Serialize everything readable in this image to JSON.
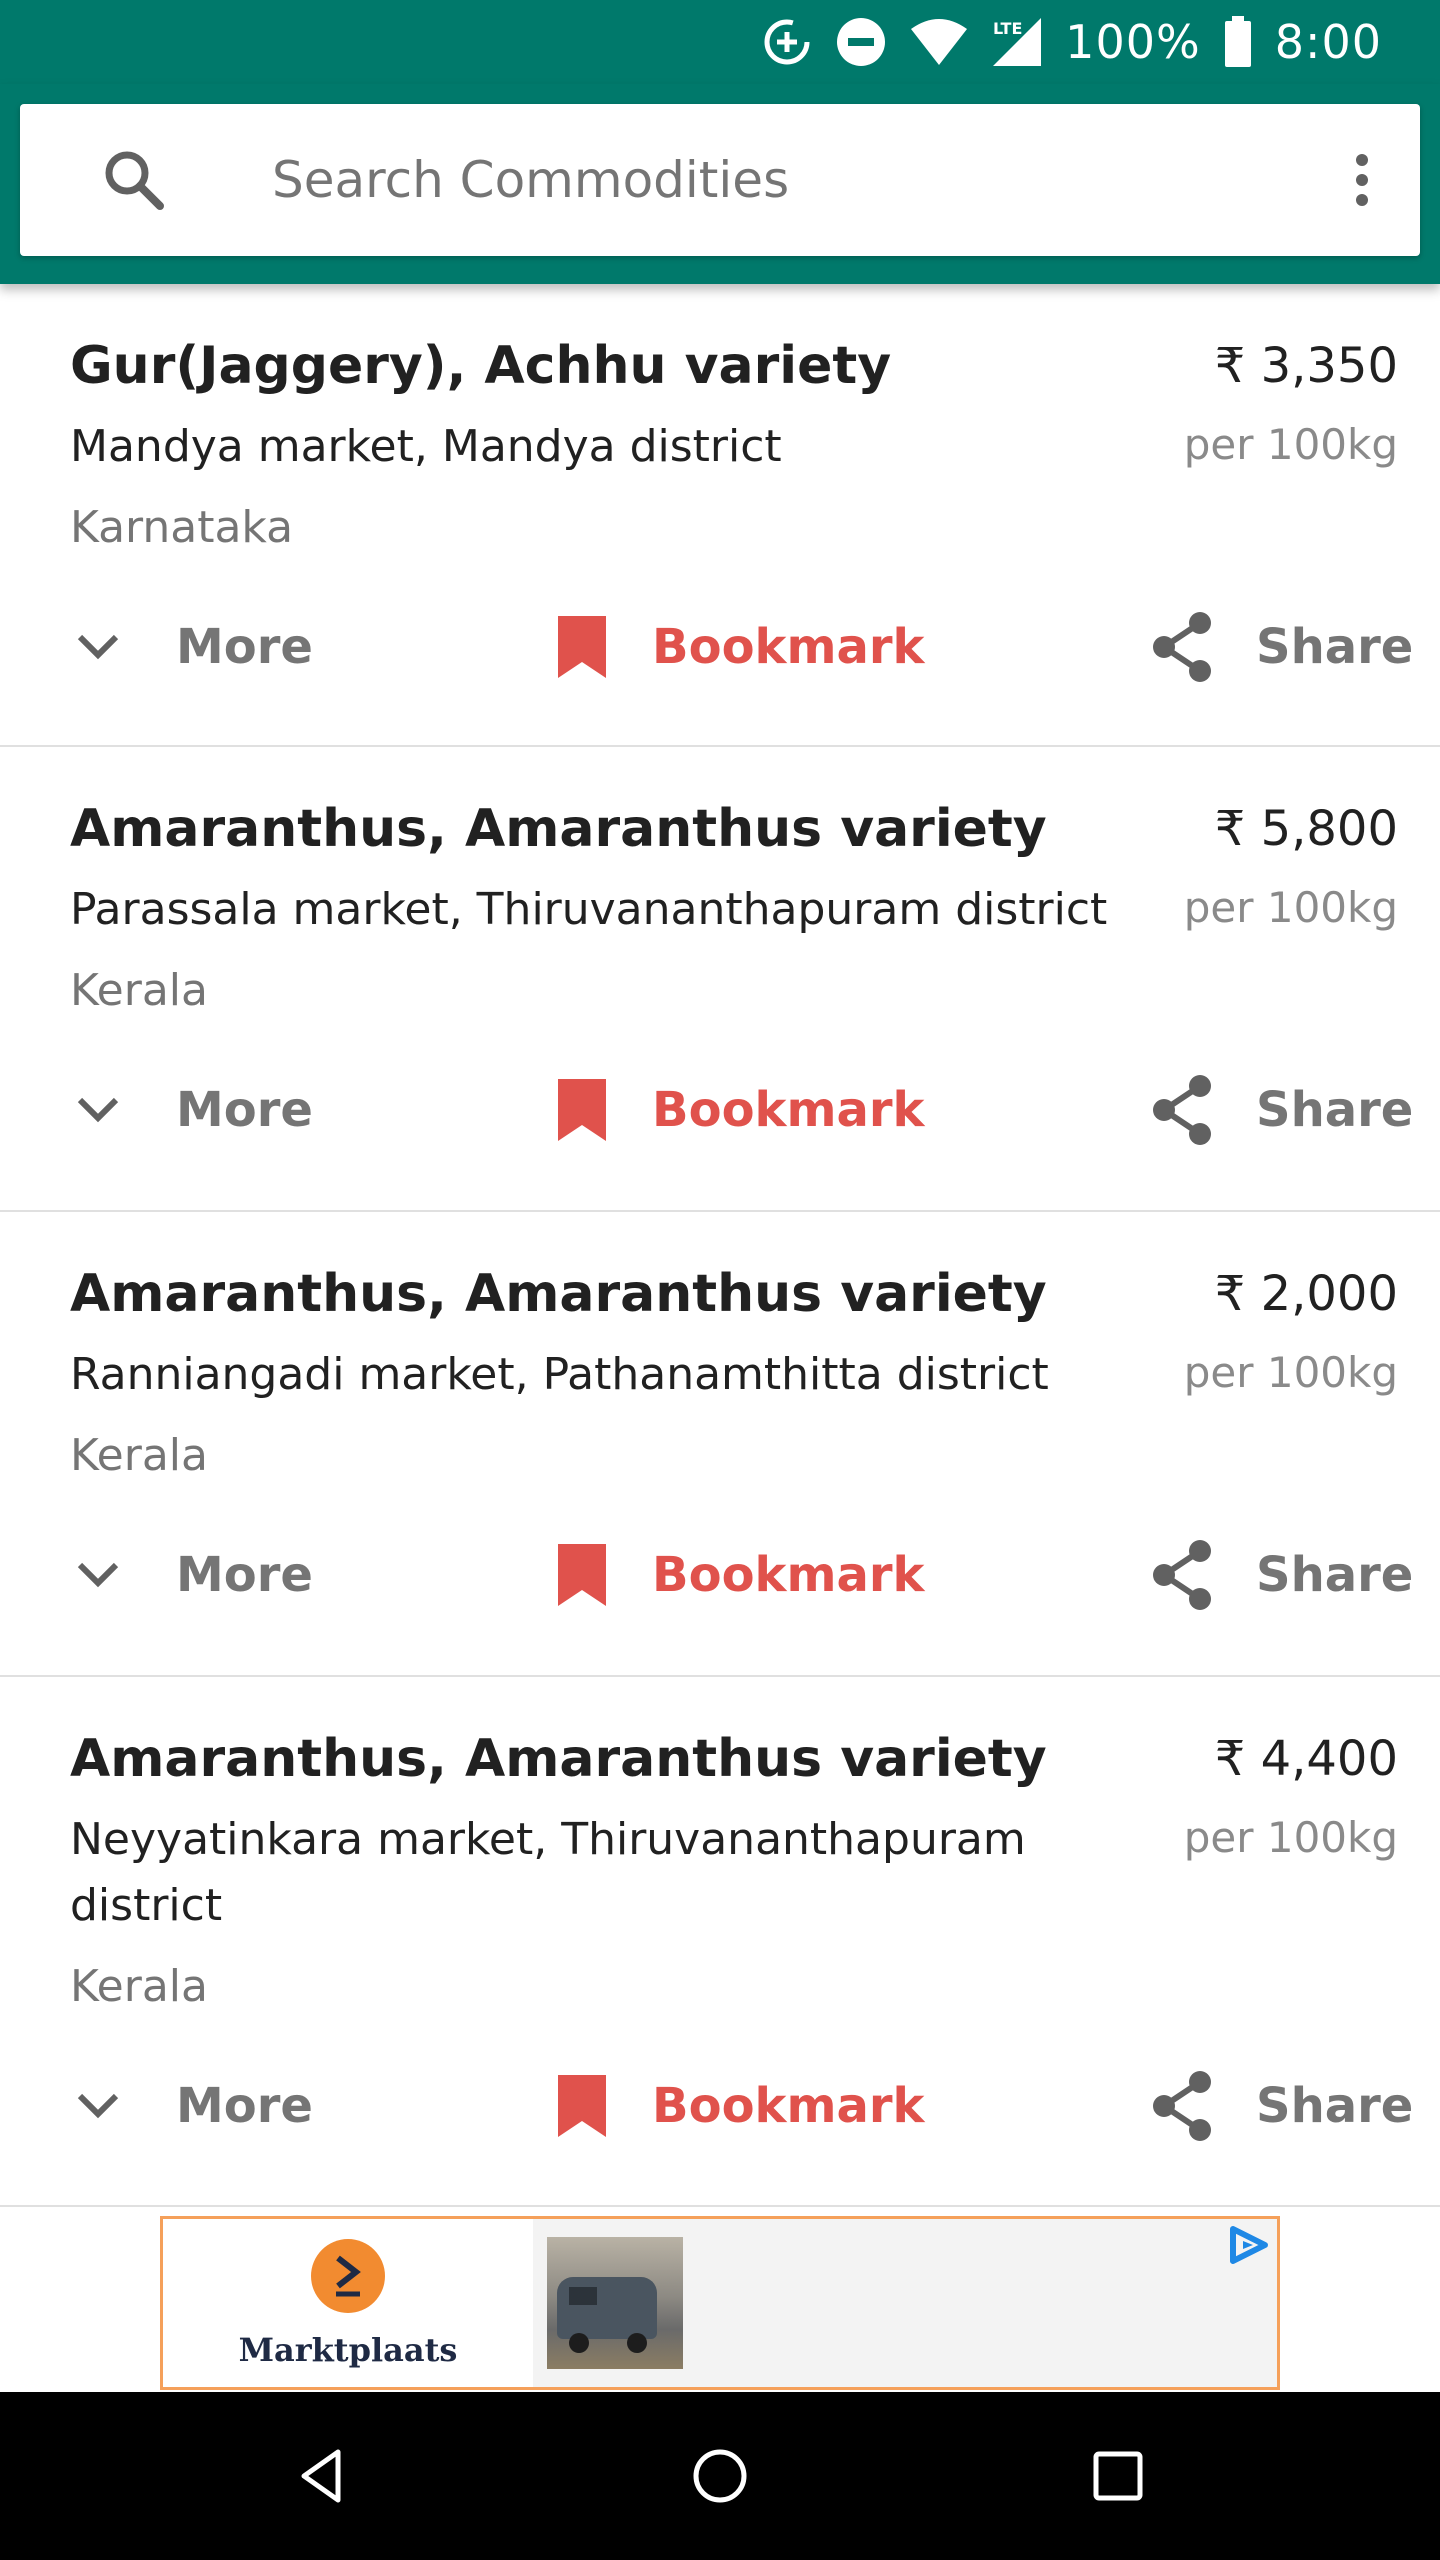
{
  "status_bar": {
    "battery": "100%",
    "time": "8:00",
    "network": "LTE"
  },
  "search": {
    "placeholder": "Search Commodities"
  },
  "actions": {
    "more": "More",
    "bookmark": "Bookmark",
    "share": "Share"
  },
  "items": [
    {
      "title": "Gur(Jaggery), Achhu variety",
      "price": "₹ 3,350",
      "unit": "per 100kg",
      "market": "Mandya market, Mandya district",
      "state": "Karnataka"
    },
    {
      "title": "Amaranthus, Amaranthus variety",
      "price": "₹ 5,800",
      "unit": "per 100kg",
      "market": "Parassala market, Thiruvananthapuram district",
      "state": "Kerala"
    },
    {
      "title": "Amaranthus, Amaranthus variety",
      "price": "₹ 2,000",
      "unit": "per 100kg",
      "market": "Ranniangadi market, Pathanamthitta district",
      "state": "Kerala"
    },
    {
      "title": "Amaranthus, Amaranthus variety",
      "price": "₹ 4,400",
      "unit": "per 100kg",
      "market": "Neyyatinkara market, Thiruvananthapuram district",
      "state": "Kerala"
    }
  ],
  "ad": {
    "brand": "Marktplaats"
  },
  "colors": {
    "primary": "#00796b",
    "bookmark": "#e0524c",
    "secondary_text": "#757575"
  }
}
